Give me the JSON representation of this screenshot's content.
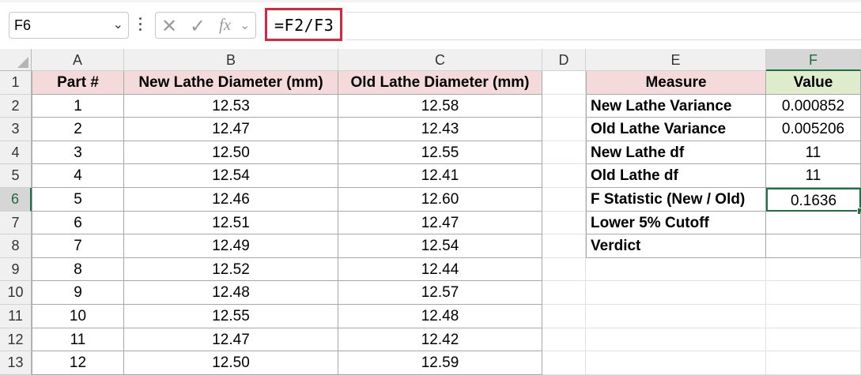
{
  "name_box": {
    "value": "F6"
  },
  "formula_bar": {
    "formula": "=F2/F3",
    "fx_label": "fx"
  },
  "columns": [
    "A",
    "B",
    "C",
    "D",
    "E",
    "F"
  ],
  "rows": [
    "1",
    "2",
    "3",
    "4",
    "5",
    "6",
    "7",
    "8",
    "9",
    "10",
    "11",
    "12",
    "13"
  ],
  "selected": {
    "column": "F",
    "row": "6"
  },
  "table1": {
    "headers": [
      "Part #",
      "New Lathe Diameter (mm)",
      "Old Lathe Diameter (mm)"
    ],
    "rows": [
      [
        "1",
        "12.53",
        "12.58"
      ],
      [
        "2",
        "12.47",
        "12.43"
      ],
      [
        "3",
        "12.50",
        "12.55"
      ],
      [
        "4",
        "12.54",
        "12.41"
      ],
      [
        "5",
        "12.46",
        "12.60"
      ],
      [
        "6",
        "12.51",
        "12.47"
      ],
      [
        "7",
        "12.49",
        "12.54"
      ],
      [
        "8",
        "12.52",
        "12.44"
      ],
      [
        "9",
        "12.48",
        "12.57"
      ],
      [
        "10",
        "12.55",
        "12.48"
      ],
      [
        "11",
        "12.47",
        "12.42"
      ],
      [
        "12",
        "12.50",
        "12.59"
      ]
    ]
  },
  "table2": {
    "headers": [
      "Measure",
      "Value"
    ],
    "rows": [
      [
        "New Lathe Variance",
        "0.000852"
      ],
      [
        "Old Lathe Variance",
        "0.005206"
      ],
      [
        "New Lathe df",
        "11"
      ],
      [
        "Old Lathe df",
        "11"
      ],
      [
        "F Statistic (New / Old)",
        "0.1636"
      ],
      [
        "Lower 5% Cutoff",
        ""
      ],
      [
        "Verdict",
        ""
      ]
    ]
  },
  "colors": {
    "accent_green": "#1e7145",
    "header_pink": "#f4dada",
    "header_green": "#dfeccc",
    "formula_highlight": "#d7263d"
  }
}
